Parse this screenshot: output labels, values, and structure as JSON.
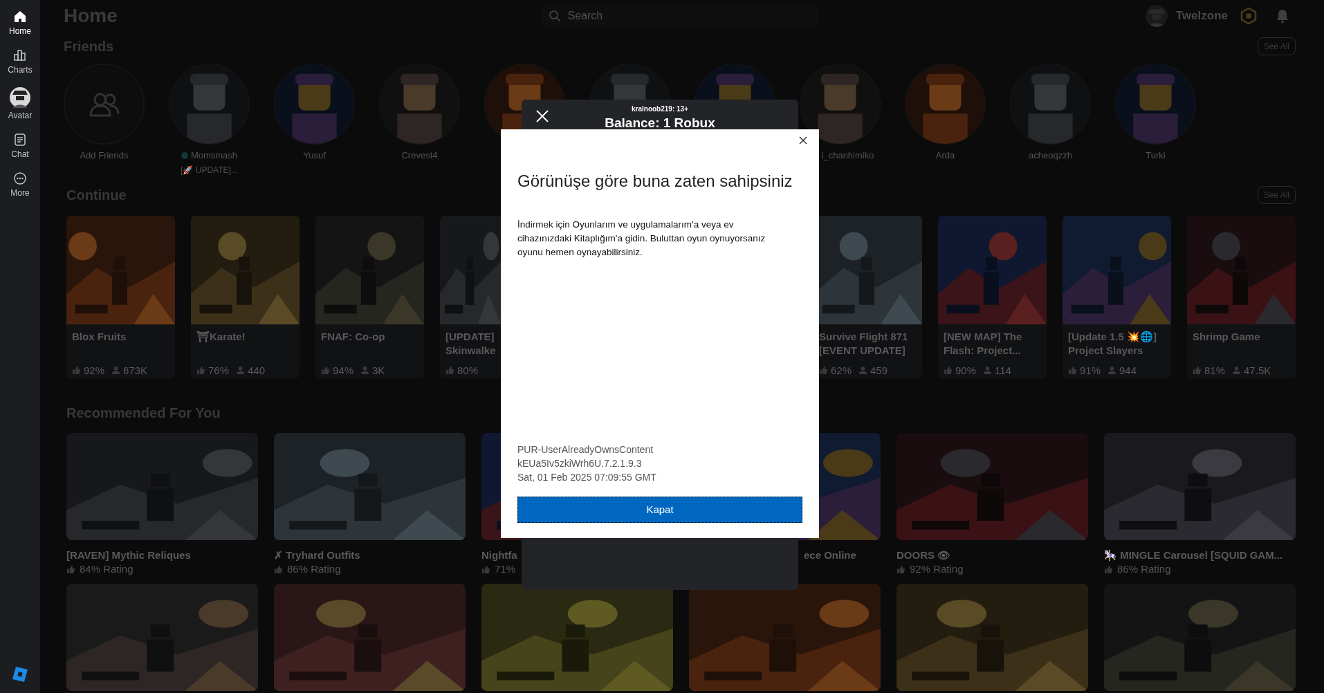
{
  "sidebar": {
    "items": [
      {
        "kind": "home",
        "label": "Home",
        "selected": true
      },
      {
        "kind": "charts",
        "label": "Charts",
        "selected": false
      },
      {
        "kind": "avatar",
        "label": "Avatar",
        "selected": false
      },
      {
        "kind": "chat",
        "label": "Chat",
        "selected": false
      },
      {
        "kind": "more",
        "label": "More",
        "selected": false
      }
    ]
  },
  "header": {
    "title": "Home",
    "search": {
      "placeholder": "Search"
    },
    "username": "Twelzone"
  },
  "friends": {
    "heading": "Friends",
    "see_all": "See All",
    "items": [
      {
        "kind": "add",
        "name": "Add Friends",
        "online": false
      },
      {
        "kind": "friend",
        "name": "Momsmash",
        "online": true,
        "activity": "[🚀 UPDATE]..."
      },
      {
        "kind": "friend",
        "name": "Yusuf",
        "online": false
      },
      {
        "kind": "friend",
        "name": "Crevest4",
        "online": false
      },
      {
        "kind": "friend"
      },
      {
        "kind": "friend"
      },
      {
        "kind": "friend"
      },
      {
        "kind": "covered_friend",
        "name": "i_chanhimiko",
        "online": false
      },
      {
        "kind": "friend",
        "name": "Arda",
        "online": false
      },
      {
        "kind": "friend",
        "name": "acheoqzzh",
        "online": false
      },
      {
        "kind": "friend",
        "name": "Turki",
        "online": false
      }
    ]
  },
  "continue": {
    "heading": "Continue",
    "see_all": "See All",
    "cards": [
      {
        "title_lines": [
          "Blox Fruits"
        ],
        "rating": "92%",
        "players": "673K"
      },
      {
        "title_lines": [
          "⛩Karate!"
        ],
        "rating": "76%",
        "players": "440"
      },
      {
        "title_lines": [
          "FNAF: Co-op"
        ],
        "rating": "94%",
        "players": "3K"
      },
      {
        "kind": "covered_card",
        "title_lines": [
          "[UPDATE]",
          "Skinwalke"
        ],
        "rating": "80%"
      },
      {
        "title_lines": [
          "Survive Flight 871",
          "[EVENT UPDATE]"
        ],
        "rating": "62%",
        "players": "459"
      },
      {
        "title_lines": [
          "[NEW MAP] The",
          "Flash: Project..."
        ],
        "rating": "90%",
        "players": "114"
      },
      {
        "title_lines": [
          "[Update 1.5 💥🌐]",
          "Project Slayers"
        ],
        "rating": "91%",
        "players": "944"
      },
      {
        "title_lines": [
          "Shrimp Game"
        ],
        "rating": "81%",
        "players": "47.5K"
      }
    ]
  },
  "recommended": {
    "heading": "Recommended For You",
    "cards": [
      {
        "kind": "game",
        "title": "[RAVEN] Mythic Reliques",
        "rating": "84% Rating"
      },
      {
        "kind": "game",
        "title": "✗ Tryhard Outfits",
        "rating": "86% Rating"
      },
      {
        "kind": "game",
        "title": "Nightfa",
        "rating": "71%"
      },
      {
        "kind": "covered_game",
        "title": "ece Online"
      },
      {
        "kind": "game",
        "title": "DOORS 👁",
        "rating": "92% Rating"
      },
      {
        "kind": "game",
        "title": "🎠 MINGLE Carousel [SQUID GAM...",
        "rating": "86% Rating"
      },
      {
        "kind": "picture"
      },
      {
        "kind": "picture"
      },
      {
        "kind": "picture"
      },
      {
        "kind": "picture"
      },
      {
        "kind": "picture"
      },
      {
        "kind": "picture"
      }
    ]
  },
  "purchase_panel": {
    "subtitle": "kralnoob219: 13+",
    "balance": "Balance: 1 Robux"
  },
  "dialog": {
    "title": "Görünüşe göre buna zaten sahipsiniz",
    "message": "İndirmek için Oyunlarım ve uygulamalarım'a veya ev cihazınızdaki Kitaplığım'a gidin. Buluttan oyun oynuyorsanız oyunu hemen oynayabilirsiniz.",
    "details": [
      "PUR-UserAlreadyOwnsContent",
      "kEUa5Iv5zkiWrh6U.7.2.1.9.3",
      "Sat, 01 Feb 2025 07:09:55 GMT"
    ],
    "button": "Kapat"
  }
}
